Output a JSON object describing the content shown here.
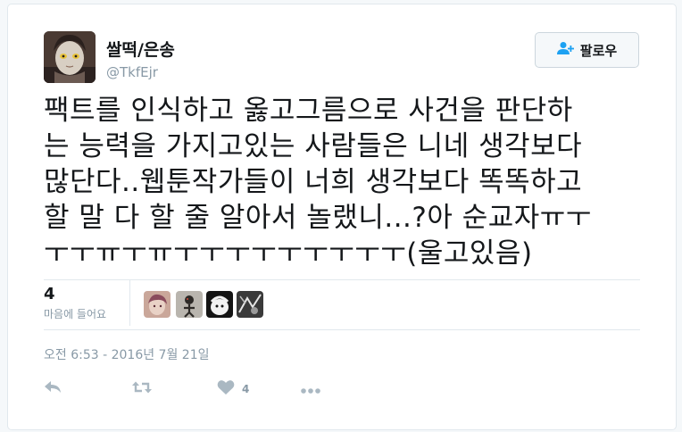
{
  "tweet": {
    "display_name": "쌀떡/은송",
    "handle": "@TkfEjr",
    "follow_label": "팔로우",
    "text_lines": [
      "팩트를 인식하고 옳고그름으로 사건을 판단하",
      "는 능력을 가지고있는 사람들은 니네 생각보다",
      "많단다..웹툰작가들이 너희 생각보다 똑똑하고",
      "할 말 다 할 줄 알아서 놀랬니...?아 순교자ㅠㅜ",
      "ㅜㅜㅠㅜㅠㅜㅜㅜㅜㅜㅜㅜㅜㅜ(울고있음)"
    ],
    "likes_count": "4",
    "likes_label": "마음에 들어요",
    "timestamp": "오전 6:53 - 2016년 7월 21일",
    "actions": {
      "reply_icon": "reply-icon",
      "retweet_icon": "retweet-icon",
      "like_icon": "heart-icon",
      "like_count": "4",
      "more_icon": "more-icon"
    }
  },
  "colors": {
    "text": "#14171a",
    "muted": "#8899a6",
    "border": "#e1e8ed",
    "background": "#f5f8fa"
  }
}
